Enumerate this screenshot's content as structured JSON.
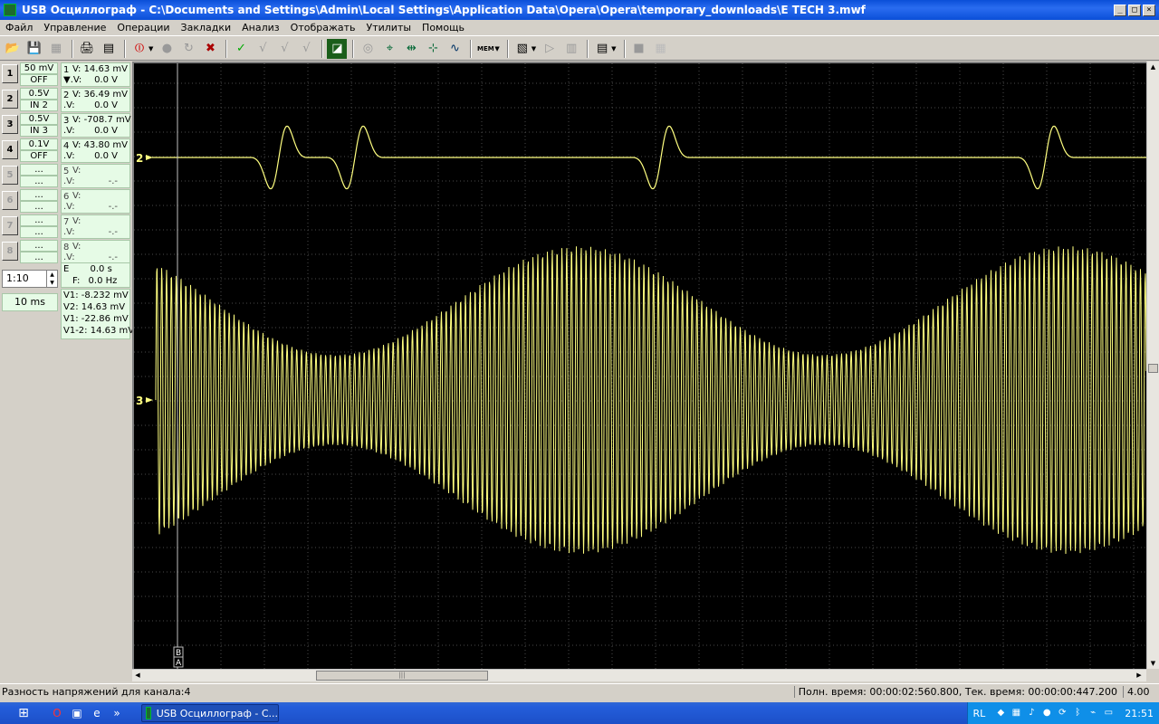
{
  "window": {
    "title": "USB Осциллограф - C:\\Documents and Settings\\Admin\\Local Settings\\Application Data\\Opera\\Opera\\temporary_downloads\\E TECH 3.mwf",
    "min": "_",
    "max": "□",
    "close": "×"
  },
  "menu": [
    "Файл",
    "Управление",
    "Операции",
    "Закладки",
    "Анализ",
    "Отображать",
    "Утилиты",
    "Помощь"
  ],
  "toolbar": {
    "open": "📂",
    "save": "💾",
    "print": "🖨",
    "stop": "⏼",
    "record": "●",
    "check": "✓",
    "mem_label": "MEM"
  },
  "channels": [
    {
      "btn": "1",
      "scale": "50 mV",
      "input": "OFF",
      "num": "1",
      "v": "V: 14.63 mV",
      "dv_label": "▼.V:",
      "dv": "0.0 V"
    },
    {
      "btn": "2",
      "scale": "0.5V",
      "input": "IN 2",
      "num": "2",
      "v": "V: 36.49 mV",
      "dv_label": ".V:",
      "dv": "0.0 V"
    },
    {
      "btn": "3",
      "scale": "0.5V",
      "input": "IN 3",
      "num": "3",
      "v": "V: -708.7 mV",
      "dv_label": ".V:",
      "dv": "0.0 V"
    },
    {
      "btn": "4",
      "scale": "0.1V",
      "input": "OFF",
      "num": "4",
      "v": "V: 43.80 mV",
      "dv_label": ".V:",
      "dv": "0.0 V"
    },
    {
      "btn": "5",
      "scale": "...",
      "input": "...",
      "num": "5",
      "v": "V:",
      "dv_label": ".V:",
      "dv": "-.-"
    },
    {
      "btn": "6",
      "scale": "...",
      "input": "...",
      "num": "6",
      "v": "V:",
      "dv_label": ".V:",
      "dv": "-.-"
    },
    {
      "btn": "7",
      "scale": "...",
      "input": "...",
      "num": "7",
      "v": "V:",
      "dv_label": ".V:",
      "dv": "-.-"
    },
    {
      "btn": "8",
      "scale": "...",
      "input": "...",
      "num": "8",
      "v": "V:",
      "dv_label": ".V:",
      "dv": "-.-"
    }
  ],
  "ratio": "1:10",
  "timebase": "10 ms",
  "extra": {
    "e_label": "E",
    "e_value": "0.0 s",
    "f_label": "F:",
    "f_value": "0.0 Hz"
  },
  "cursors": [
    "V1: -8.232 mV",
    "V2: 14.63 mV",
    "V1: -22.86 mV",
    "V1-2: 14.63 mV"
  ],
  "scope": {
    "marker_2": "2",
    "marker_3": "3",
    "cursor_b": "B",
    "cursor_a": "A",
    "trace_color": "#ffff80",
    "grid_color": "#4a4a4a"
  },
  "status": {
    "left": "Разность напряжений для канала:4",
    "right": "Полн. время: 00:00:02:560.800, Тек. время: 00:00:00:447.200",
    "zoom": "4.00"
  },
  "taskbar": {
    "task": "USB Осциллограф - С...",
    "lang": "RL",
    "clock": "21:51"
  }
}
